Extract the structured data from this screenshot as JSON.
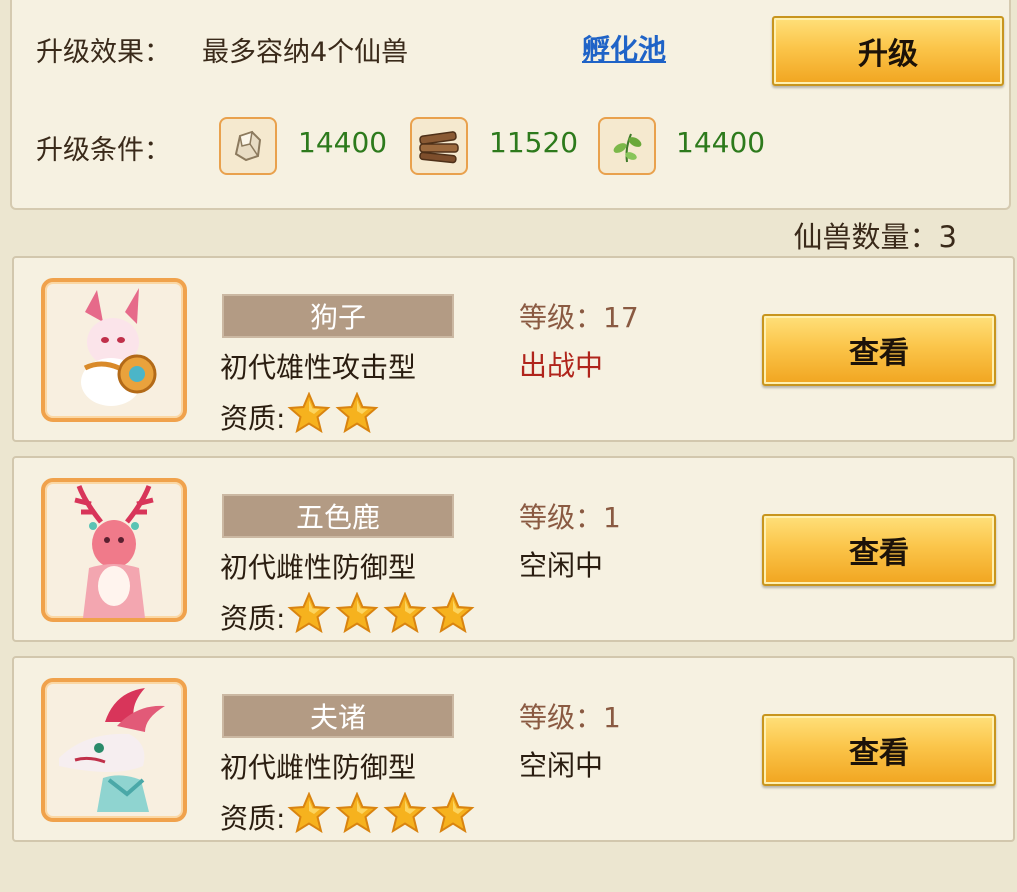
{
  "upgrade": {
    "effect_label": "升级效果：",
    "effect_value": "最多容纳4个仙兽",
    "link_text": "孵化池",
    "button_label": "升级",
    "condition_label": "升级条件：",
    "resources": [
      {
        "icon": "stone-icon",
        "amount": "14400"
      },
      {
        "icon": "wood-icon",
        "amount": "11520"
      },
      {
        "icon": "herb-icon",
        "amount": "14400"
      }
    ]
  },
  "beast_count": "仙兽数量：3",
  "beasts": [
    {
      "name": "狗子",
      "desc": "初代雄性攻击型",
      "quality_label": "资质:",
      "stars": 2,
      "level": "等级：17",
      "status": "出战中",
      "status_color": "#b0241b",
      "button": "查看"
    },
    {
      "name": "五色鹿",
      "desc": "初代雌性防御型",
      "quality_label": "资质:",
      "stars": 4,
      "level": "等级：1",
      "status": "空闲中",
      "status_color": "#2a1d10",
      "button": "查看"
    },
    {
      "name": "夫诸",
      "desc": "初代雌性防御型",
      "quality_label": "资质:",
      "stars": 4,
      "level": "等级：1",
      "status": "空闲中",
      "status_color": "#2a1d10",
      "button": "查看"
    }
  ]
}
